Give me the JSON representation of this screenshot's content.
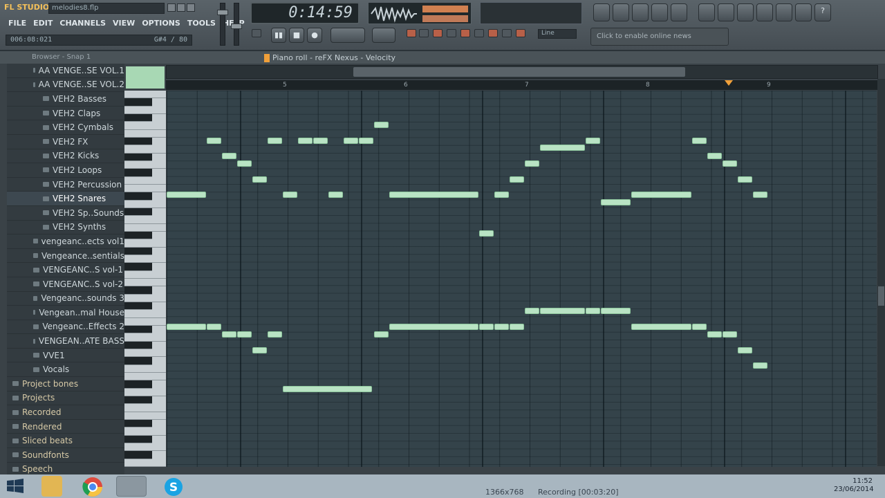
{
  "app": {
    "logo": "FL STUDIO",
    "filename": "melodies8.flp",
    "menu": [
      "FILE",
      "EDIT",
      "CHANNELS",
      "VIEW",
      "OPTIONS",
      "TOOLS",
      "HELP"
    ],
    "position": "006:08:021",
    "position_right": "G#4 / 80",
    "time": "0:14:59",
    "tempo_mode": "Line",
    "news": "Click to enable online news"
  },
  "browser": {
    "header": "Browser - Snap 1",
    "items": [
      {
        "label": "AA VENGE..SE VOL.1",
        "type": "folder"
      },
      {
        "label": "AA VENGE..SE VOL.2",
        "type": "folder"
      },
      {
        "label": "VEH2 Basses",
        "type": "folder"
      },
      {
        "label": "VEH2 Claps",
        "type": "folder"
      },
      {
        "label": "VEH2 Cymbals",
        "type": "folder"
      },
      {
        "label": "VEH2 FX",
        "type": "folder"
      },
      {
        "label": "VEH2 Kicks",
        "type": "folder"
      },
      {
        "label": "VEH2 Loops",
        "type": "folder"
      },
      {
        "label": "VEH2 Percussion",
        "type": "folder"
      },
      {
        "label": "VEH2 Snares",
        "type": "folder",
        "selected": true
      },
      {
        "label": "VEH2 Sp..Sounds",
        "type": "folder"
      },
      {
        "label": "VEH2 Synths",
        "type": "folder"
      },
      {
        "label": "vengeanc..ects vol1",
        "type": "folder"
      },
      {
        "label": "Vengeance..sentials",
        "type": "folder"
      },
      {
        "label": "VENGEANC..S vol-1",
        "type": "folder"
      },
      {
        "label": "VENGEANC..S vol-2",
        "type": "folder"
      },
      {
        "label": "Vengeanc..sounds 3",
        "type": "folder"
      },
      {
        "label": "Vengean..mal House",
        "type": "folder"
      },
      {
        "label": "Vengeanc..Effects 2",
        "type": "folder"
      },
      {
        "label": "VENGEAN..ATE BASS",
        "type": "folder"
      },
      {
        "label": "VVE1",
        "type": "folder"
      },
      {
        "label": "Vocals",
        "type": "folder"
      },
      {
        "label": "Project bones",
        "type": "category"
      },
      {
        "label": "Projects",
        "type": "category"
      },
      {
        "label": "Recorded",
        "type": "category"
      },
      {
        "label": "Rendered",
        "type": "category"
      },
      {
        "label": "Sliced beats",
        "type": "category"
      },
      {
        "label": "Soundfonts",
        "type": "category"
      },
      {
        "label": "Speech",
        "type": "category"
      }
    ]
  },
  "pianoroll": {
    "title": "Piano roll - reFX Nexus",
    "target": "Velocity",
    "ruler": [
      "5",
      "6",
      "7",
      "8",
      "9"
    ]
  },
  "taskbar": {
    "resolution": "1366x768",
    "recording": "Recording [00:03:20]",
    "time": "11:52",
    "date": "23/06/2014"
  },
  "colors": {
    "note": "#b9e3c4",
    "grid": "#34434a",
    "accent": "#f0a03a"
  }
}
